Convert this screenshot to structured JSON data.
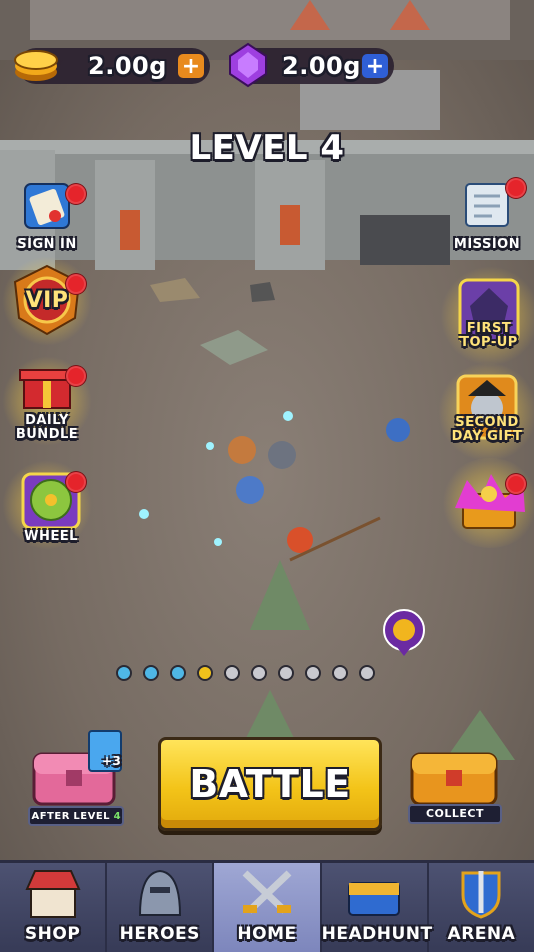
{
  "currency": {
    "gold": {
      "value": "2.00g",
      "icon": "gold-coin-icon",
      "plus": "+",
      "plus_color": "#e88a1e"
    },
    "gems": {
      "value": "2.00g",
      "icon": "purple-gem-icon",
      "plus": "+",
      "plus_color": "#2f5fd6"
    }
  },
  "level_title": "LEVEL 4",
  "left_buttons": [
    {
      "label": "SIGN IN",
      "icon": "scroll-signin-icon"
    },
    {
      "label": "VIP",
      "icon": "vip-badge-icon"
    },
    {
      "label": "DAILY\nBUNDLE",
      "icon": "gift-box-icon"
    },
    {
      "label": "WHEEL",
      "icon": "prize-wheel-icon"
    }
  ],
  "right_buttons": [
    {
      "label": "MISSION",
      "icon": "mission-scroll-icon"
    },
    {
      "label": "FIRST\nTOP-UP",
      "icon": "dragon-icon"
    },
    {
      "label": "SECOND\nDAY GIFT",
      "icon": "pirate-icon"
    },
    {
      "label": "",
      "icon": "treasure-pile-icon"
    }
  ],
  "pager": {
    "count": 10,
    "current": 4,
    "done_color": "#4fb7e6",
    "current_color": "#f0c21c",
    "todo_color": "#c9c9cf"
  },
  "battle_label": "BATTLE",
  "left_chest": {
    "label_prefix": "AFTER",
    "label_level": "LEVEL",
    "label_num": "4",
    "badge": "+3"
  },
  "right_chest": {
    "label": "COLLECT"
  },
  "nav": [
    {
      "label": "SHOP",
      "icon": "shop-icon",
      "active": false
    },
    {
      "label": "HEROES",
      "icon": "helmet-icon",
      "active": false
    },
    {
      "label": "HOME",
      "icon": "crossed-swords-icon",
      "active": true
    },
    {
      "label": "HEADHUNT",
      "icon": "chest-icon",
      "active": false
    },
    {
      "label": "ARENA",
      "icon": "sword-shield-icon",
      "active": false
    }
  ]
}
